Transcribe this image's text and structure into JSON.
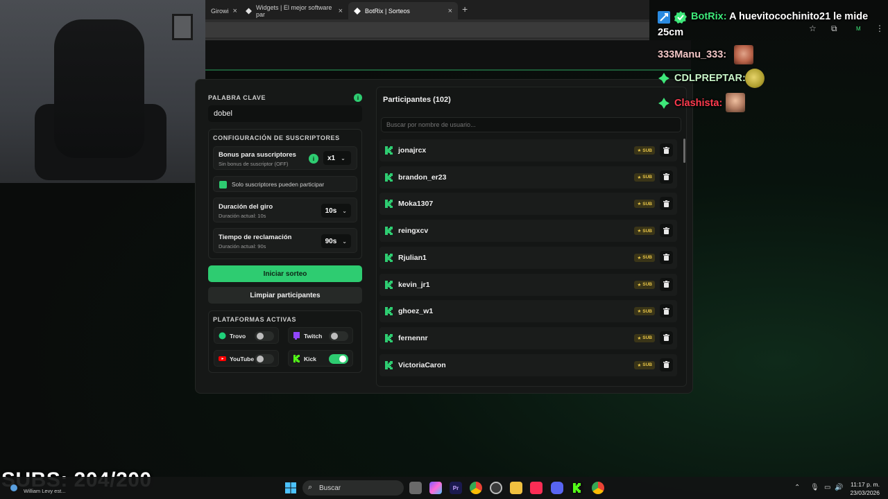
{
  "browser": {
    "tabs": [
      {
        "label": "Girowi"
      },
      {
        "label": "Widgets | El mejor software par"
      },
      {
        "label": "BotRix | Sorteos"
      }
    ],
    "new_tab": "+",
    "icons": [
      "star-icon",
      "extensions-icon",
      "profile-icon",
      "menu-icon"
    ],
    "profile_letter": "M"
  },
  "giveaway": {
    "keyword_section": "PALABRA CLAVE",
    "keyword_value": "dobel",
    "subs_config_title": "CONFIGURACIÓN DE SUSCRIPTORES",
    "bonus_label": "Bonus para suscriptores",
    "bonus_sub": "Sin bonus de suscriptor (OFF)",
    "bonus_value": "x1",
    "subs_only_label": "Solo suscriptores pueden participar",
    "spin_label": "Duración del giro",
    "spin_sub": "Duración actual: 10s",
    "spin_value": "10s",
    "claim_label": "Tiempo de reclamación",
    "claim_sub": "Duración actual: 90s",
    "claim_value": "90s",
    "start_button": "Iniciar sorteo",
    "clear_button": "Limpiar participantes",
    "platforms_title": "PLATAFORMAS ACTIVAS",
    "platforms": [
      {
        "name": "Trovo",
        "enabled": false,
        "color": "#1fd17a"
      },
      {
        "name": "Twitch",
        "enabled": false,
        "color": "#9146ff"
      },
      {
        "name": "YouTube",
        "enabled": false,
        "color": "#ff0000"
      },
      {
        "name": "Kick",
        "enabled": true,
        "color": "#53fc18"
      }
    ]
  },
  "participants": {
    "title": "Participantes (102)",
    "search_placeholder": "Buscar por nombre de usuario...",
    "badge": "SUB",
    "list": [
      "jonajrcx",
      "brandon_er23",
      "Moka1307",
      "reingxcv",
      "Rjulian1",
      "kevin_jr1",
      "ghoez_w1",
      "fernennr",
      "VictoriaCaron"
    ]
  },
  "chat": {
    "messages": [
      {
        "user": "BotRix:",
        "text": "A huevitocochinito21 le mide",
        "text2": "25cm",
        "user_color": "#3ee87a"
      },
      {
        "user": "333Manu_333:",
        "text": "",
        "user_color": "#f2c6c6"
      },
      {
        "user": "CDLPREPTAR:",
        "text": "",
        "user_color": "#c8f5c8"
      },
      {
        "user": "Clashista:",
        "text": "",
        "user_color": "#ff3b4e"
      }
    ]
  },
  "overlay": {
    "subs_counter": "SUBS: 204/200"
  },
  "taskbar": {
    "left_text": "William Levy est...",
    "search_label": "Buscar",
    "time": "11:17 p. m.",
    "date": "23/03/2026"
  },
  "colors": {
    "accent": "#2ecc71",
    "kick": "#53fc18",
    "badge": "#e8c547"
  }
}
